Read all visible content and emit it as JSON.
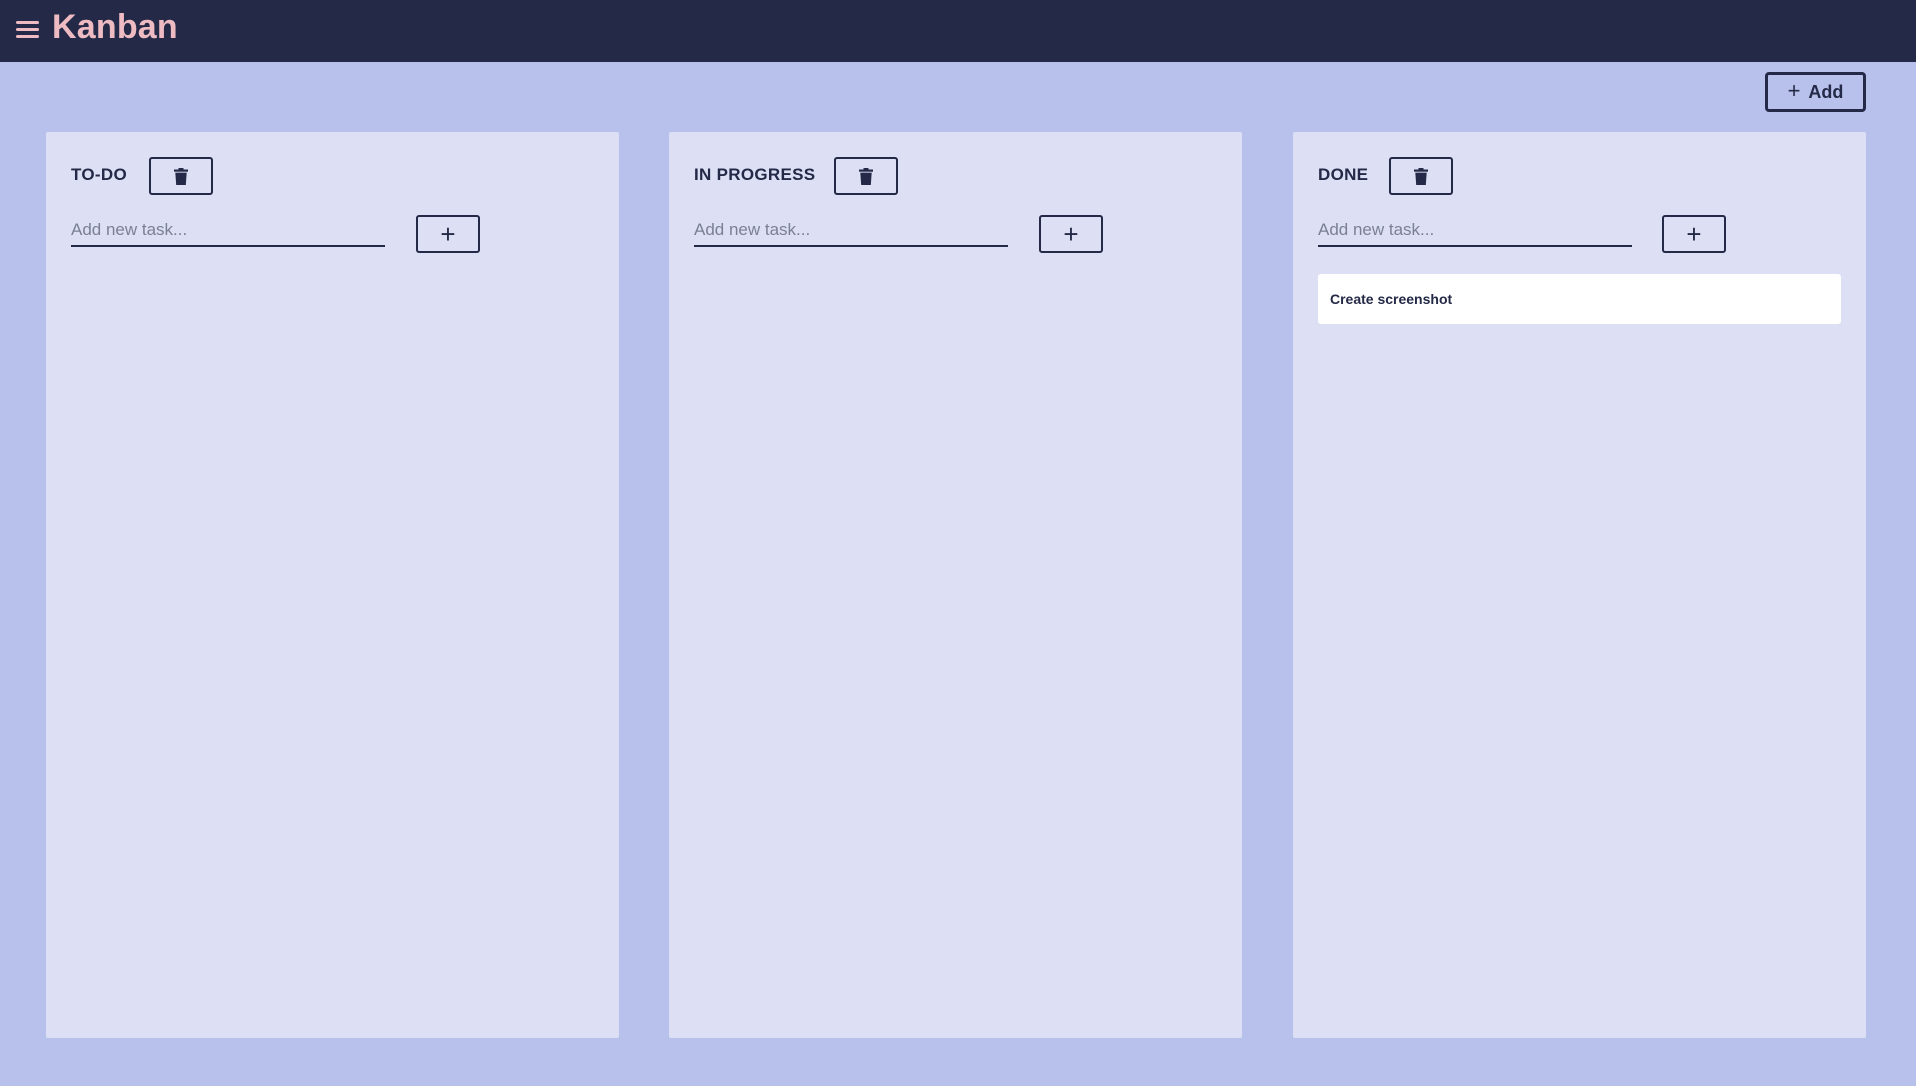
{
  "app": {
    "title": "Kanban",
    "menu_icon": "hamburger-menu-icon",
    "add_button_label": "Add",
    "add_button_icon": "plus-icon"
  },
  "colors": {
    "header_bg": "#232946",
    "page_bg": "#b8c1ec",
    "column_bg": "#dde0f4",
    "accent": "#eebbc3",
    "text": "#232946",
    "card_bg": "#ffffff"
  },
  "columns": [
    {
      "title": "TO-DO",
      "delete_icon": "trash-icon",
      "input_placeholder": "Add new task...",
      "input_value": "",
      "add_task_label": "+",
      "tasks": []
    },
    {
      "title": "IN PROGRESS",
      "delete_icon": "trash-icon",
      "input_placeholder": "Add new task...",
      "input_value": "",
      "add_task_label": "+",
      "tasks": []
    },
    {
      "title": "DONE",
      "delete_icon": "trash-icon",
      "input_placeholder": "Add new task...",
      "input_value": "",
      "add_task_label": "+",
      "tasks": [
        "Create screenshot"
      ]
    }
  ]
}
